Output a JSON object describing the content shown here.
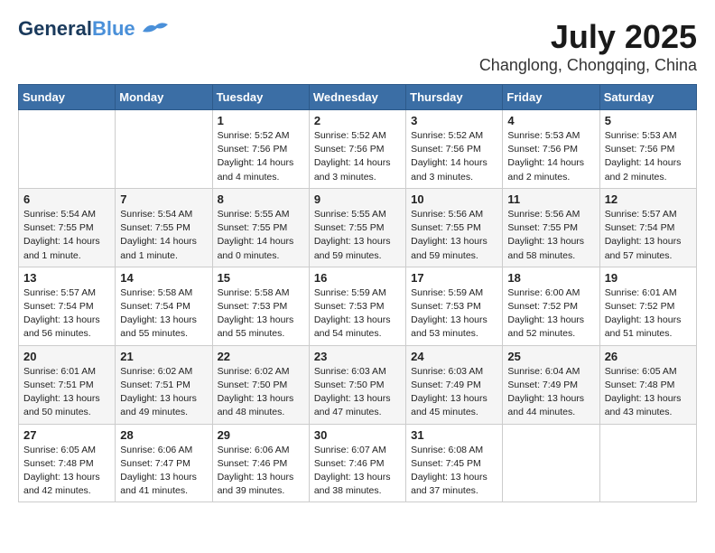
{
  "logo": {
    "line1": "General",
    "line2": "Blue"
  },
  "title": "July 2025",
  "subtitle": "Changlong, Chongqing, China",
  "days_of_week": [
    "Sunday",
    "Monday",
    "Tuesday",
    "Wednesday",
    "Thursday",
    "Friday",
    "Saturday"
  ],
  "weeks": [
    [
      {
        "day": "",
        "info": ""
      },
      {
        "day": "",
        "info": ""
      },
      {
        "day": "1",
        "info": "Sunrise: 5:52 AM\nSunset: 7:56 PM\nDaylight: 14 hours\nand 4 minutes."
      },
      {
        "day": "2",
        "info": "Sunrise: 5:52 AM\nSunset: 7:56 PM\nDaylight: 14 hours\nand 3 minutes."
      },
      {
        "day": "3",
        "info": "Sunrise: 5:52 AM\nSunset: 7:56 PM\nDaylight: 14 hours\nand 3 minutes."
      },
      {
        "day": "4",
        "info": "Sunrise: 5:53 AM\nSunset: 7:56 PM\nDaylight: 14 hours\nand 2 minutes."
      },
      {
        "day": "5",
        "info": "Sunrise: 5:53 AM\nSunset: 7:56 PM\nDaylight: 14 hours\nand 2 minutes."
      }
    ],
    [
      {
        "day": "6",
        "info": "Sunrise: 5:54 AM\nSunset: 7:55 PM\nDaylight: 14 hours\nand 1 minute."
      },
      {
        "day": "7",
        "info": "Sunrise: 5:54 AM\nSunset: 7:55 PM\nDaylight: 14 hours\nand 1 minute."
      },
      {
        "day": "8",
        "info": "Sunrise: 5:55 AM\nSunset: 7:55 PM\nDaylight: 14 hours\nand 0 minutes."
      },
      {
        "day": "9",
        "info": "Sunrise: 5:55 AM\nSunset: 7:55 PM\nDaylight: 13 hours\nand 59 minutes."
      },
      {
        "day": "10",
        "info": "Sunrise: 5:56 AM\nSunset: 7:55 PM\nDaylight: 13 hours\nand 59 minutes."
      },
      {
        "day": "11",
        "info": "Sunrise: 5:56 AM\nSunset: 7:55 PM\nDaylight: 13 hours\nand 58 minutes."
      },
      {
        "day": "12",
        "info": "Sunrise: 5:57 AM\nSunset: 7:54 PM\nDaylight: 13 hours\nand 57 minutes."
      }
    ],
    [
      {
        "day": "13",
        "info": "Sunrise: 5:57 AM\nSunset: 7:54 PM\nDaylight: 13 hours\nand 56 minutes."
      },
      {
        "day": "14",
        "info": "Sunrise: 5:58 AM\nSunset: 7:54 PM\nDaylight: 13 hours\nand 55 minutes."
      },
      {
        "day": "15",
        "info": "Sunrise: 5:58 AM\nSunset: 7:53 PM\nDaylight: 13 hours\nand 55 minutes."
      },
      {
        "day": "16",
        "info": "Sunrise: 5:59 AM\nSunset: 7:53 PM\nDaylight: 13 hours\nand 54 minutes."
      },
      {
        "day": "17",
        "info": "Sunrise: 5:59 AM\nSunset: 7:53 PM\nDaylight: 13 hours\nand 53 minutes."
      },
      {
        "day": "18",
        "info": "Sunrise: 6:00 AM\nSunset: 7:52 PM\nDaylight: 13 hours\nand 52 minutes."
      },
      {
        "day": "19",
        "info": "Sunrise: 6:01 AM\nSunset: 7:52 PM\nDaylight: 13 hours\nand 51 minutes."
      }
    ],
    [
      {
        "day": "20",
        "info": "Sunrise: 6:01 AM\nSunset: 7:51 PM\nDaylight: 13 hours\nand 50 minutes."
      },
      {
        "day": "21",
        "info": "Sunrise: 6:02 AM\nSunset: 7:51 PM\nDaylight: 13 hours\nand 49 minutes."
      },
      {
        "day": "22",
        "info": "Sunrise: 6:02 AM\nSunset: 7:50 PM\nDaylight: 13 hours\nand 48 minutes."
      },
      {
        "day": "23",
        "info": "Sunrise: 6:03 AM\nSunset: 7:50 PM\nDaylight: 13 hours\nand 47 minutes."
      },
      {
        "day": "24",
        "info": "Sunrise: 6:03 AM\nSunset: 7:49 PM\nDaylight: 13 hours\nand 45 minutes."
      },
      {
        "day": "25",
        "info": "Sunrise: 6:04 AM\nSunset: 7:49 PM\nDaylight: 13 hours\nand 44 minutes."
      },
      {
        "day": "26",
        "info": "Sunrise: 6:05 AM\nSunset: 7:48 PM\nDaylight: 13 hours\nand 43 minutes."
      }
    ],
    [
      {
        "day": "27",
        "info": "Sunrise: 6:05 AM\nSunset: 7:48 PM\nDaylight: 13 hours\nand 42 minutes."
      },
      {
        "day": "28",
        "info": "Sunrise: 6:06 AM\nSunset: 7:47 PM\nDaylight: 13 hours\nand 41 minutes."
      },
      {
        "day": "29",
        "info": "Sunrise: 6:06 AM\nSunset: 7:46 PM\nDaylight: 13 hours\nand 39 minutes."
      },
      {
        "day": "30",
        "info": "Sunrise: 6:07 AM\nSunset: 7:46 PM\nDaylight: 13 hours\nand 38 minutes."
      },
      {
        "day": "31",
        "info": "Sunrise: 6:08 AM\nSunset: 7:45 PM\nDaylight: 13 hours\nand 37 minutes."
      },
      {
        "day": "",
        "info": ""
      },
      {
        "day": "",
        "info": ""
      }
    ]
  ]
}
